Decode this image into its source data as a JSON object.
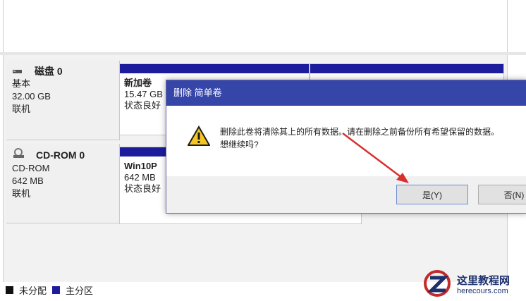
{
  "disks": [
    {
      "name": "磁盘 0",
      "type": "基本",
      "size": "32.00 GB",
      "status": "联机",
      "volume": {
        "name": "新加卷",
        "size": "15.47 GB",
        "status": "状态良好"
      }
    },
    {
      "name": "CD-ROM 0",
      "type": "CD-ROM",
      "size": "642 MB",
      "status": "联机",
      "volume": {
        "name": "Win10P",
        "size": "642 MB",
        "status": "状态良好"
      }
    }
  ],
  "legend": [
    {
      "label": "未分配",
      "color": "#111111"
    },
    {
      "label": "主分区",
      "color": "#1c1c9c"
    }
  ],
  "dialog": {
    "title": "删除 简单卷",
    "message_line1": "删除此卷将清除其上的所有数据。请在删除之前备份所有希望保留的数据。",
    "message_line2": "想继续吗?",
    "yes_label": "是(Y)",
    "no_label": "否(N)",
    "icon": "warning-icon"
  },
  "watermark": {
    "title": "这里教程网",
    "url": "herecours.com"
  },
  "colors": {
    "primary_partition": "#1c1c9c",
    "dialog_title_bg": "#3646a8",
    "arrow": "#d9302e"
  }
}
